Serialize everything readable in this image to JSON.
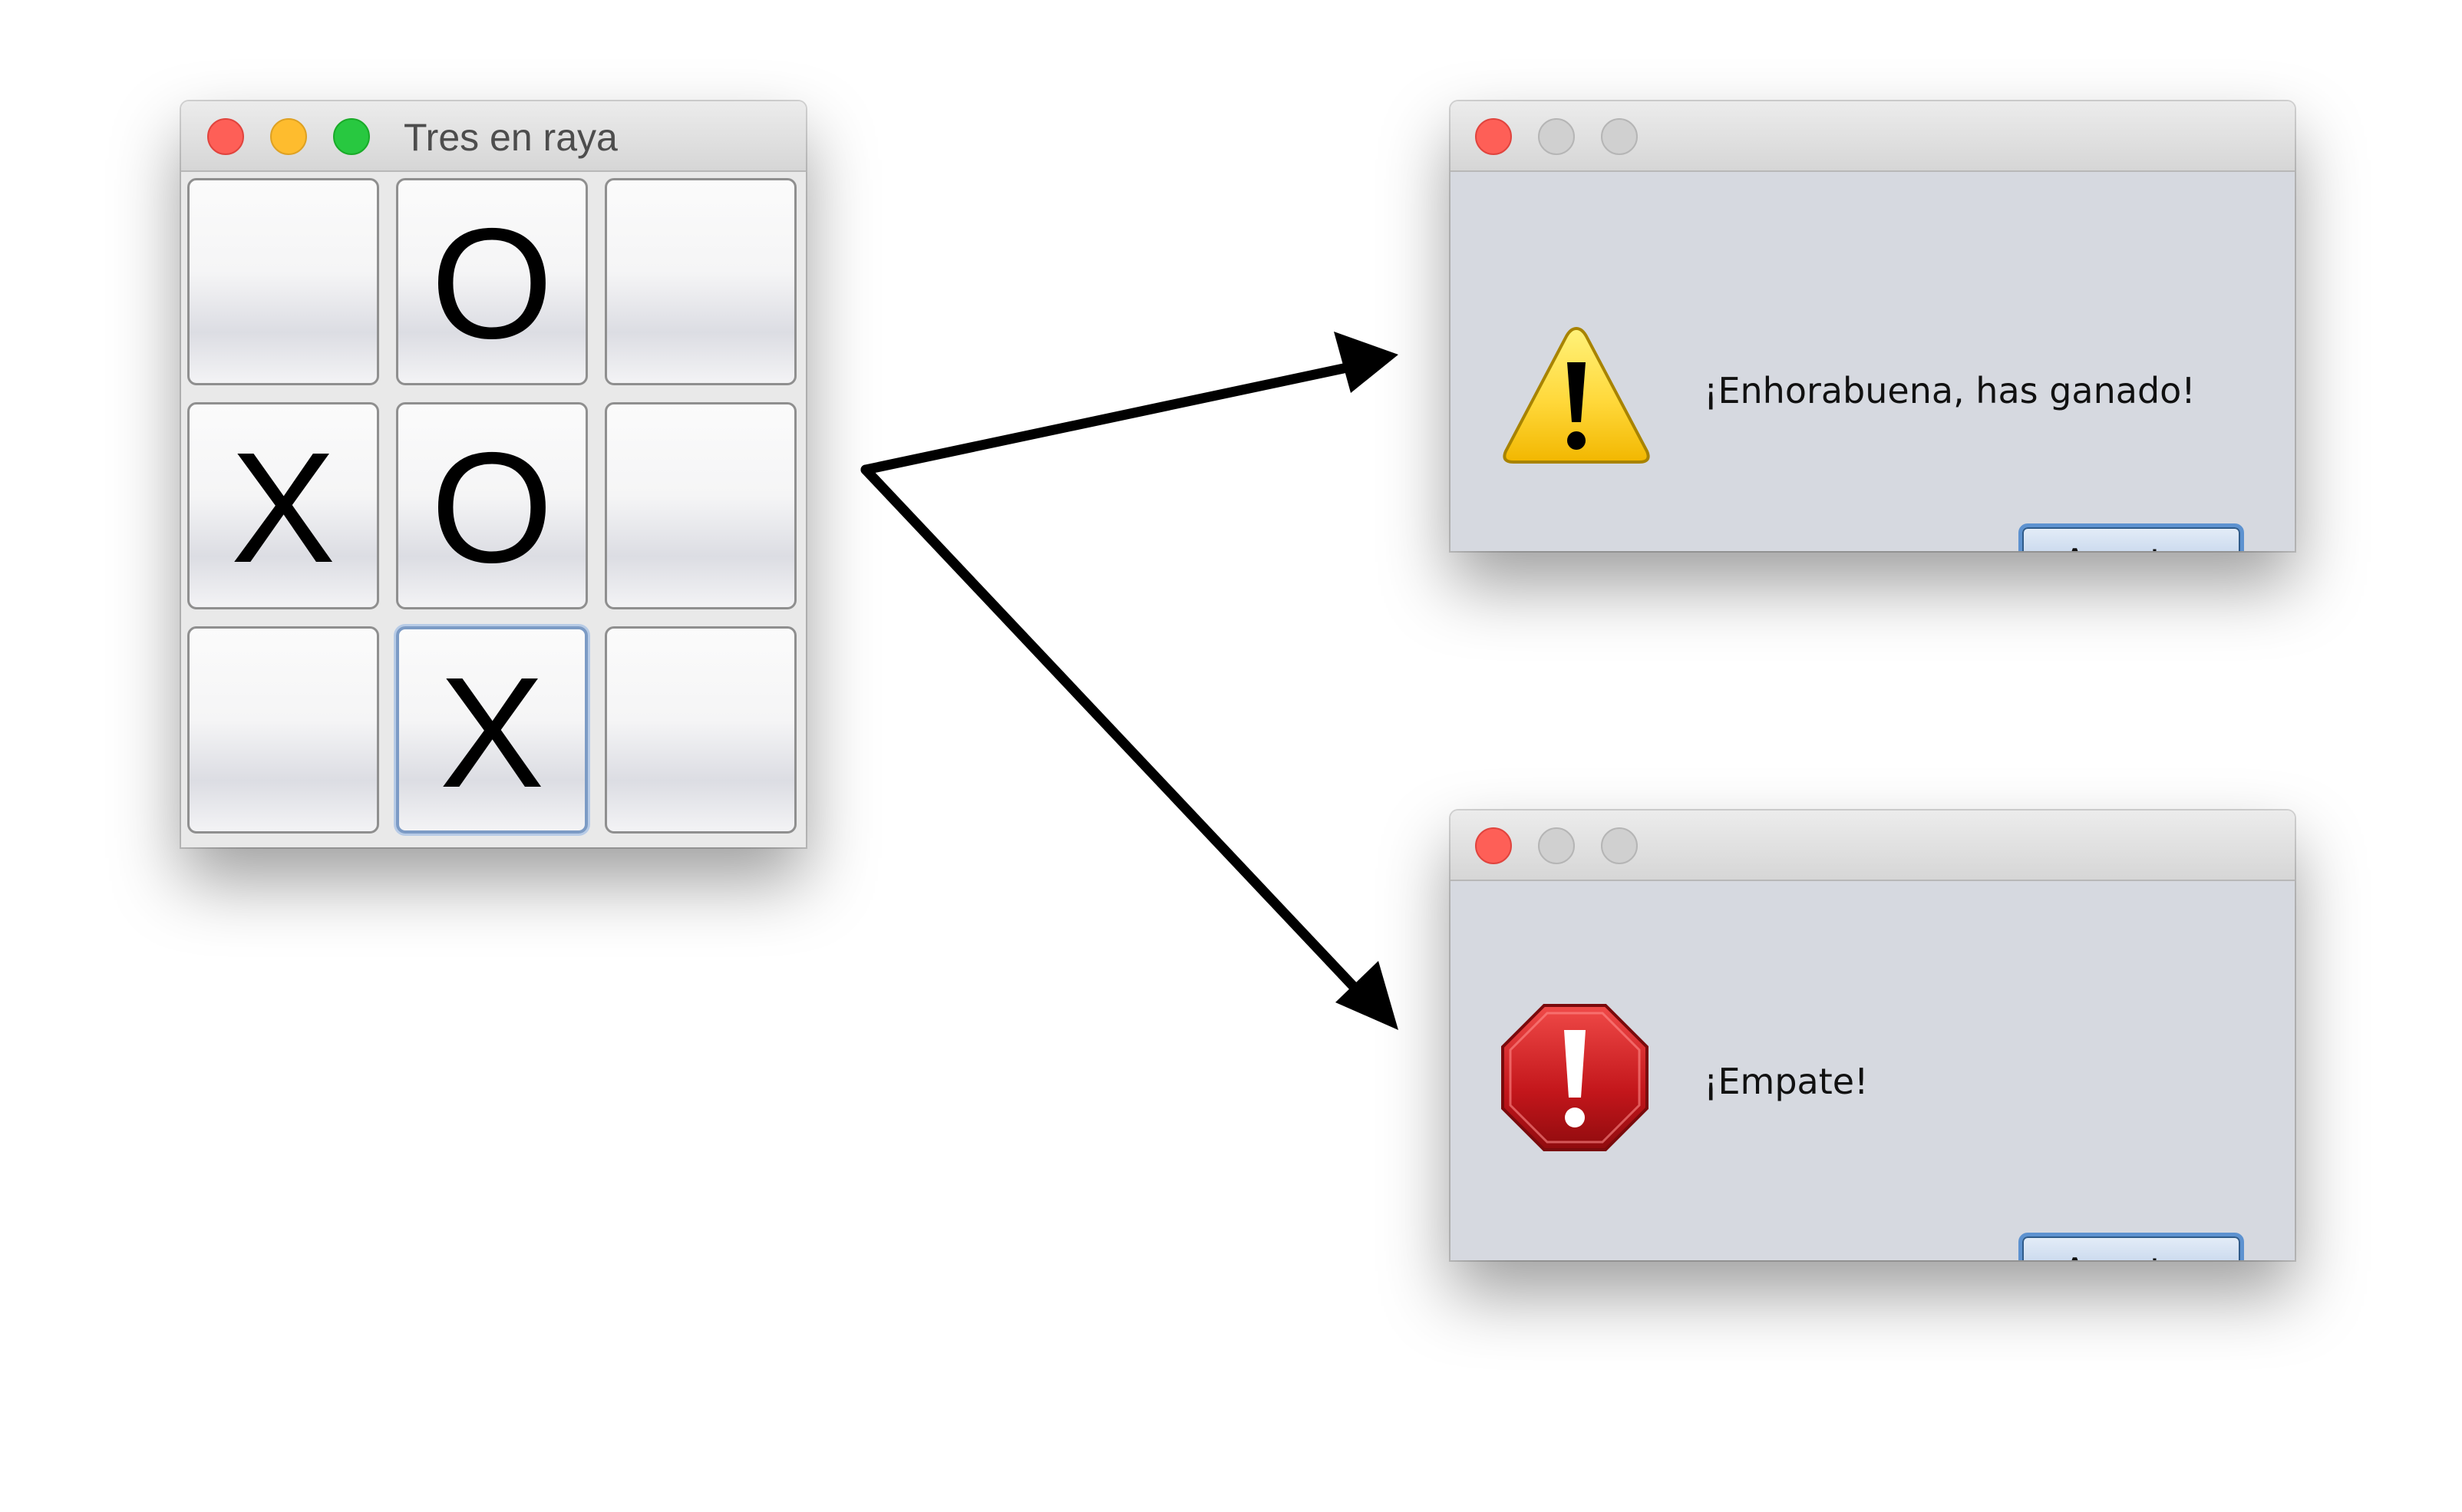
{
  "game_window": {
    "title": "Tres en raya",
    "cells": [
      "",
      "O",
      "",
      "X",
      "O",
      "",
      "",
      "X",
      ""
    ]
  },
  "win_dialog": {
    "icon": "warning-icon",
    "message": "¡Enhorabuena, has ganado!",
    "button": "Aceptar"
  },
  "draw_dialog": {
    "icon": "error-stop-icon",
    "message": "¡Empate!",
    "button": "Aceptar"
  },
  "colors": {
    "close": "#fe5f57",
    "minimize": "#febc2e",
    "zoom": "#28c840",
    "dialog_background": "#d6d9e0",
    "button_border": "#5d92d0",
    "warning_yellow": "#ffd83a",
    "stop_red": "#c3161b"
  }
}
